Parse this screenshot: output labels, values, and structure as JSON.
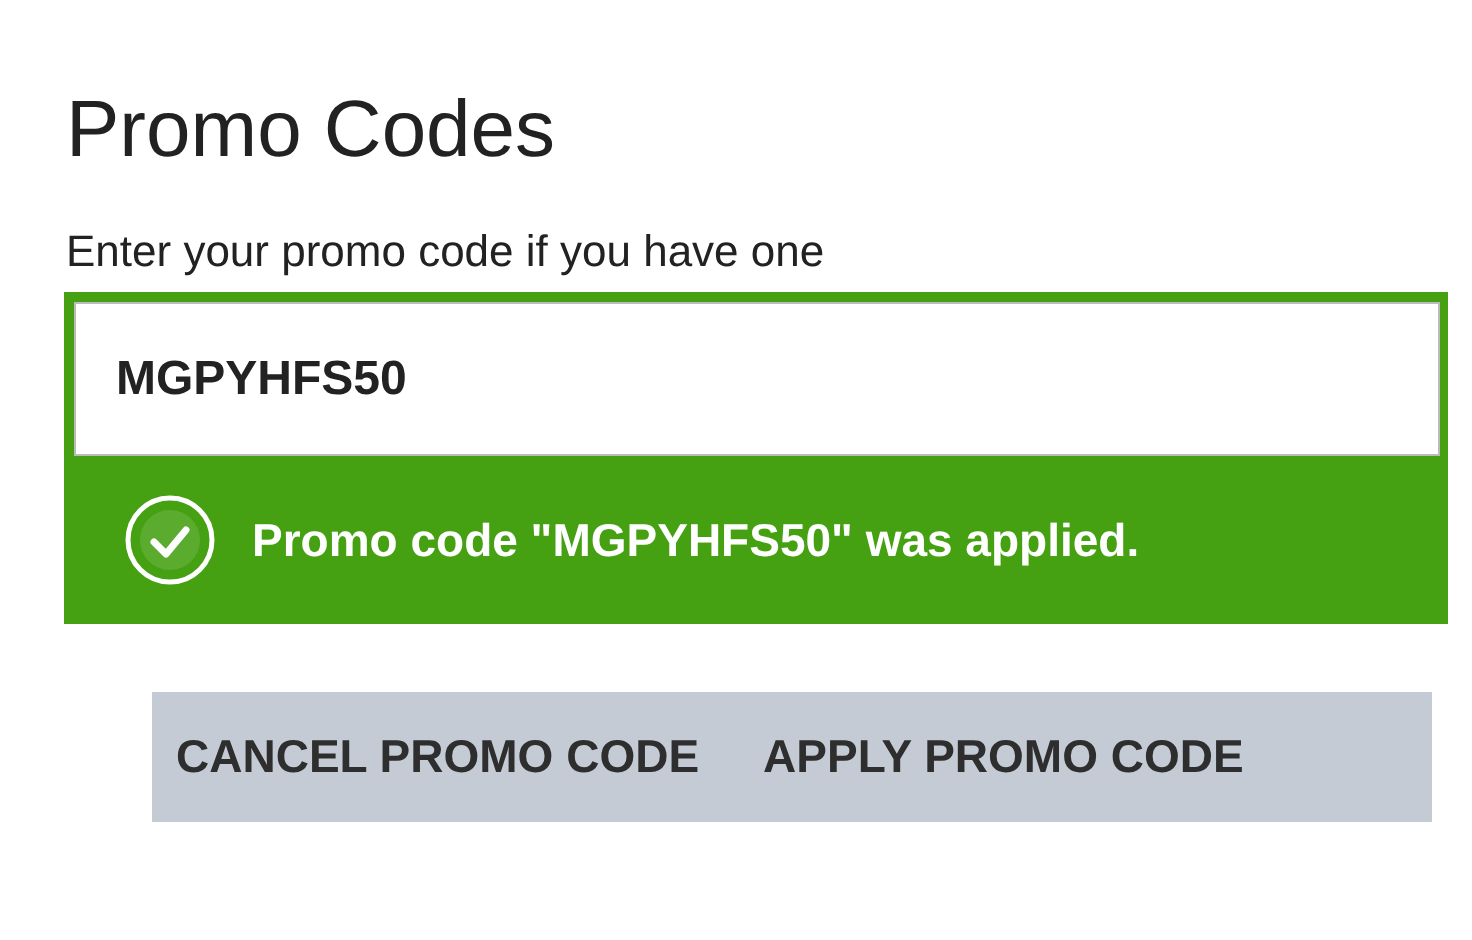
{
  "title": "Promo Codes",
  "subtitle": "Enter your promo code if you have one",
  "promo_field": {
    "value": "MGPYHFS50"
  },
  "message": {
    "text": "Promo code \"MGPYHFS50\" was applied."
  },
  "buttons": [
    {
      "label": "CANCEL PROMO CODE"
    },
    {
      "label": "APPLY PROMO CODE"
    }
  ]
}
